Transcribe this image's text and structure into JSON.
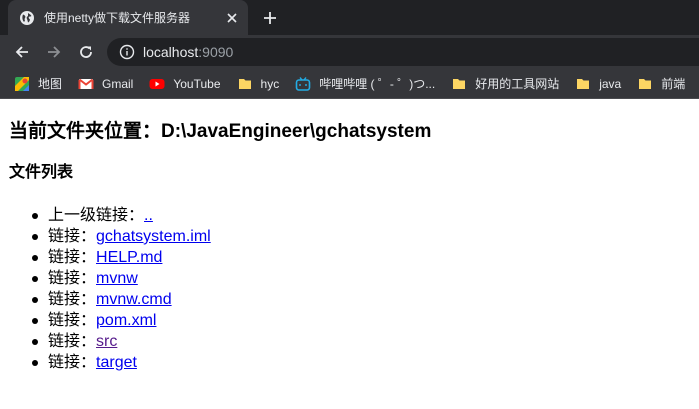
{
  "tab": {
    "title": "使用netty做下载文件服务器"
  },
  "address": {
    "host": "localhost",
    "port": ":9090"
  },
  "bookmarks": [
    {
      "label": "地图",
      "icon": "maps-icon"
    },
    {
      "label": "Gmail",
      "icon": "gmail-icon"
    },
    {
      "label": "YouTube",
      "icon": "youtube-icon"
    },
    {
      "label": "hyc",
      "icon": "folder-icon"
    },
    {
      "label": "哔哩哔哩 ( ゜- ゜)つ...",
      "icon": "bilibili-icon"
    },
    {
      "label": "好用的工具网站",
      "icon": "folder-icon"
    },
    {
      "label": "java",
      "icon": "folder-icon"
    },
    {
      "label": "前端",
      "icon": "folder-icon"
    }
  ],
  "page": {
    "heading": "当前文件夹位置：D:\\JavaEngineer\\gchatsystem",
    "subheading": "文件列表",
    "parent_prefix": "上一级链接：",
    "parent_link": "..",
    "link_prefix": "链接：",
    "files": [
      {
        "name": "gchatsystem.iml",
        "visited": false
      },
      {
        "name": "HELP.md",
        "visited": false
      },
      {
        "name": "mvnw",
        "visited": false
      },
      {
        "name": "mvnw.cmd",
        "visited": false
      },
      {
        "name": "pom.xml",
        "visited": false
      },
      {
        "name": "src",
        "visited": true
      },
      {
        "name": "target",
        "visited": false
      }
    ]
  },
  "colors": {
    "link": "#0000ee",
    "visited_link": "#551a8b",
    "chrome_dark": "#202124",
    "chrome_toolbar": "#35363a"
  }
}
